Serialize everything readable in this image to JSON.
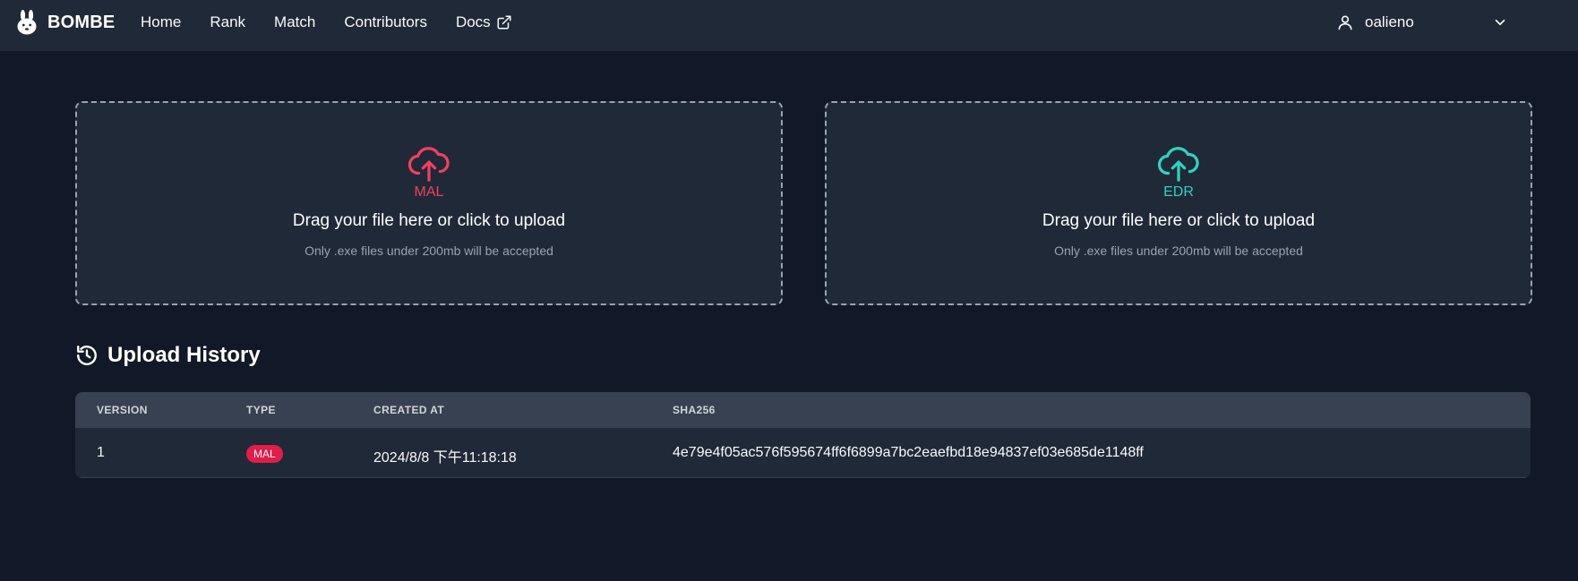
{
  "navbar": {
    "brand": "BOMBE",
    "links": [
      {
        "label": "Home"
      },
      {
        "label": "Rank"
      },
      {
        "label": "Match"
      },
      {
        "label": "Contributors"
      },
      {
        "label": "Docs"
      }
    ],
    "user": "oalieno"
  },
  "uploads": {
    "mal": {
      "label": "MAL",
      "title": "Drag your file here or click to upload",
      "hint": "Only .exe files under 200mb will be accepted",
      "icon": "cloud-upload-icon",
      "color": "#f43f5e"
    },
    "edr": {
      "label": "EDR",
      "title": "Drag your file here or click to upload",
      "hint": "Only .exe files under 200mb will be accepted",
      "icon": "cloud-upload-icon",
      "color": "#2dd4bf"
    }
  },
  "history": {
    "title": "Upload History",
    "columns": [
      "VERSION",
      "TYPE",
      "CREATED AT",
      "SHA256"
    ],
    "rows": [
      {
        "version": "1",
        "type": "MAL",
        "created_at": "2024/8/8 下午11:18:18",
        "sha256": "4e79e4f05ac576f595674ff6f6899a7bc2eaefbd18e94837ef03e685de1148ff"
      }
    ]
  },
  "colors": {
    "background": "#111827",
    "surface": "#1f2937",
    "header_row": "#374151",
    "mal_accent": "#f43f5e",
    "edr_accent": "#2dd4bf",
    "badge": "#e11d48"
  }
}
